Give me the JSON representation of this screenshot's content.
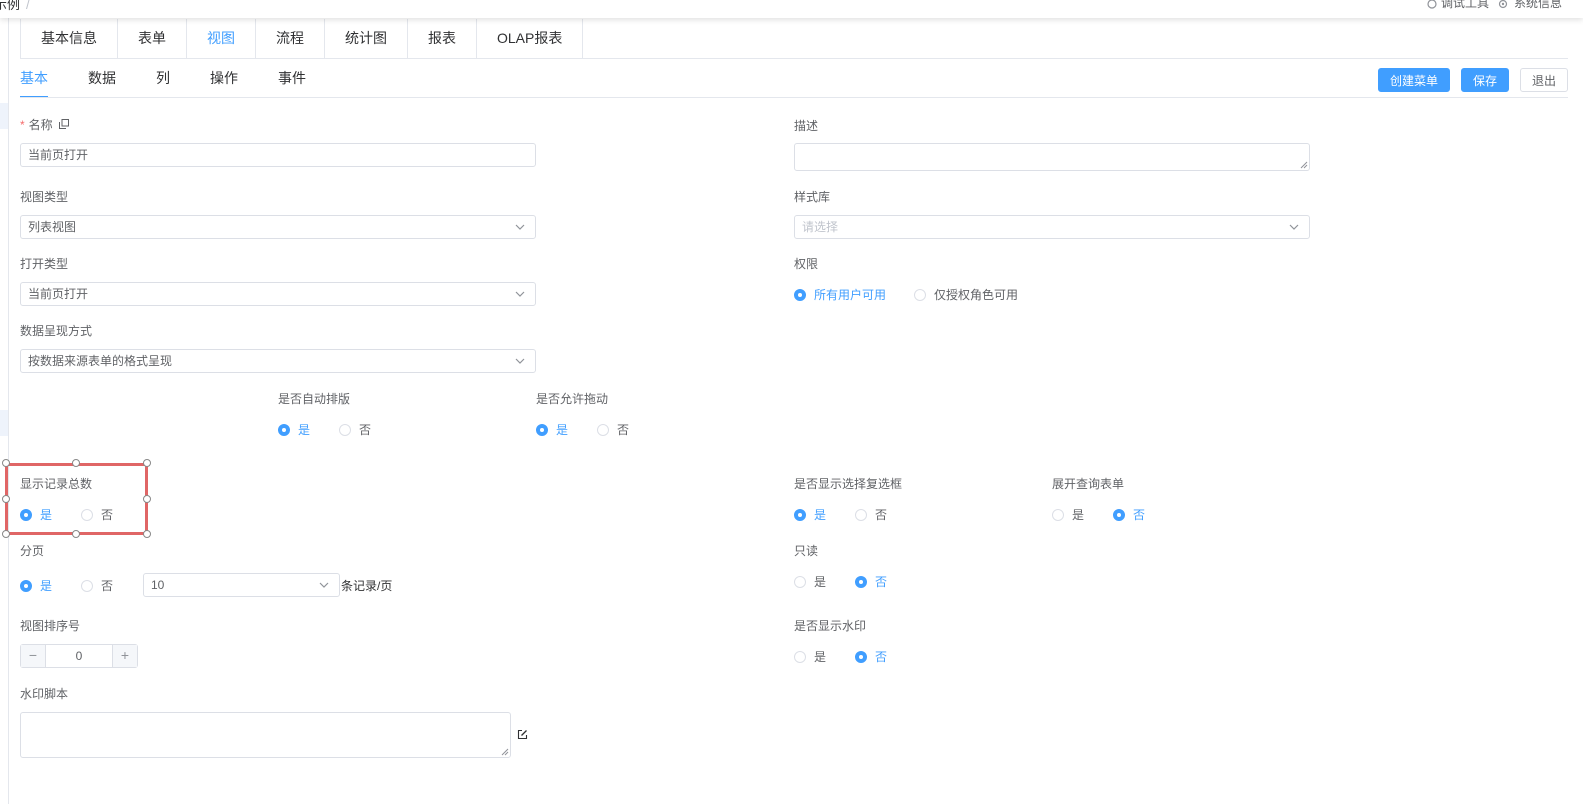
{
  "topbar": {
    "breadcrumb": "示例",
    "breadcrumb_sep": "/",
    "debug_tool": "调试工具",
    "system_info": "系统信息"
  },
  "main_tabs": [
    {
      "label": "基本信息",
      "active": false
    },
    {
      "label": "表单",
      "active": false
    },
    {
      "label": "视图",
      "active": true
    },
    {
      "label": "流程",
      "active": false
    },
    {
      "label": "统计图",
      "active": false
    },
    {
      "label": "报表",
      "active": false
    },
    {
      "label": "OLAP报表",
      "active": false
    }
  ],
  "sub_tabs": [
    {
      "label": "基本",
      "active": true
    },
    {
      "label": "数据",
      "active": false
    },
    {
      "label": "列",
      "active": false
    },
    {
      "label": "操作",
      "active": false
    },
    {
      "label": "事件",
      "active": false
    }
  ],
  "actions": {
    "create_menu": "创建菜单",
    "save": "保存",
    "exit": "退出"
  },
  "form": {
    "name": {
      "label": "名称",
      "required_mark": "*",
      "value": "当前页打开"
    },
    "description": {
      "label": "描述",
      "value": ""
    },
    "view_type": {
      "label": "视图类型",
      "value": "列表视图"
    },
    "style_lib": {
      "label": "样式库",
      "placeholder": "请选择"
    },
    "open_type": {
      "label": "打开类型",
      "value": "当前页打开"
    },
    "permission": {
      "label": "权限",
      "options": [
        "所有用户可用",
        "仅授权角色可用"
      ],
      "selected": "所有用户可用"
    },
    "data_presentation": {
      "label": "数据呈现方式",
      "value": "按数据来源表单的格式呈现"
    },
    "auto_layout": {
      "label": "是否自动排版",
      "options": [
        "是",
        "否"
      ],
      "selected": "是"
    },
    "allow_drag": {
      "label": "是否允许拖动",
      "options": [
        "是",
        "否"
      ],
      "selected": "是"
    },
    "show_total": {
      "label": "显示记录总数",
      "options": [
        "是",
        "否"
      ],
      "selected": "是"
    },
    "show_checkbox": {
      "label": "是否显示选择复选框",
      "options": [
        "是",
        "否"
      ],
      "selected": "是"
    },
    "expand_query": {
      "label": "展开查询表单",
      "options": [
        "是",
        "否"
      ],
      "selected": "否"
    },
    "pagination": {
      "label": "分页",
      "options": [
        "是",
        "否"
      ],
      "selected": "是",
      "page_size": "10",
      "unit": "条记录/页"
    },
    "readonly": {
      "label": "只读",
      "options": [
        "是",
        "否"
      ],
      "selected": "否"
    },
    "sort_no": {
      "label": "视图排序号",
      "value": "0",
      "minus": "−",
      "plus": "+"
    },
    "show_watermark": {
      "label": "是否显示水印",
      "options": [
        "是",
        "否"
      ],
      "selected": "否"
    },
    "watermark_script": {
      "label": "水印脚本",
      "value": ""
    }
  },
  "colors": {
    "accent": "#409eff",
    "selection": "#e06666",
    "required": "#f56c6c"
  }
}
